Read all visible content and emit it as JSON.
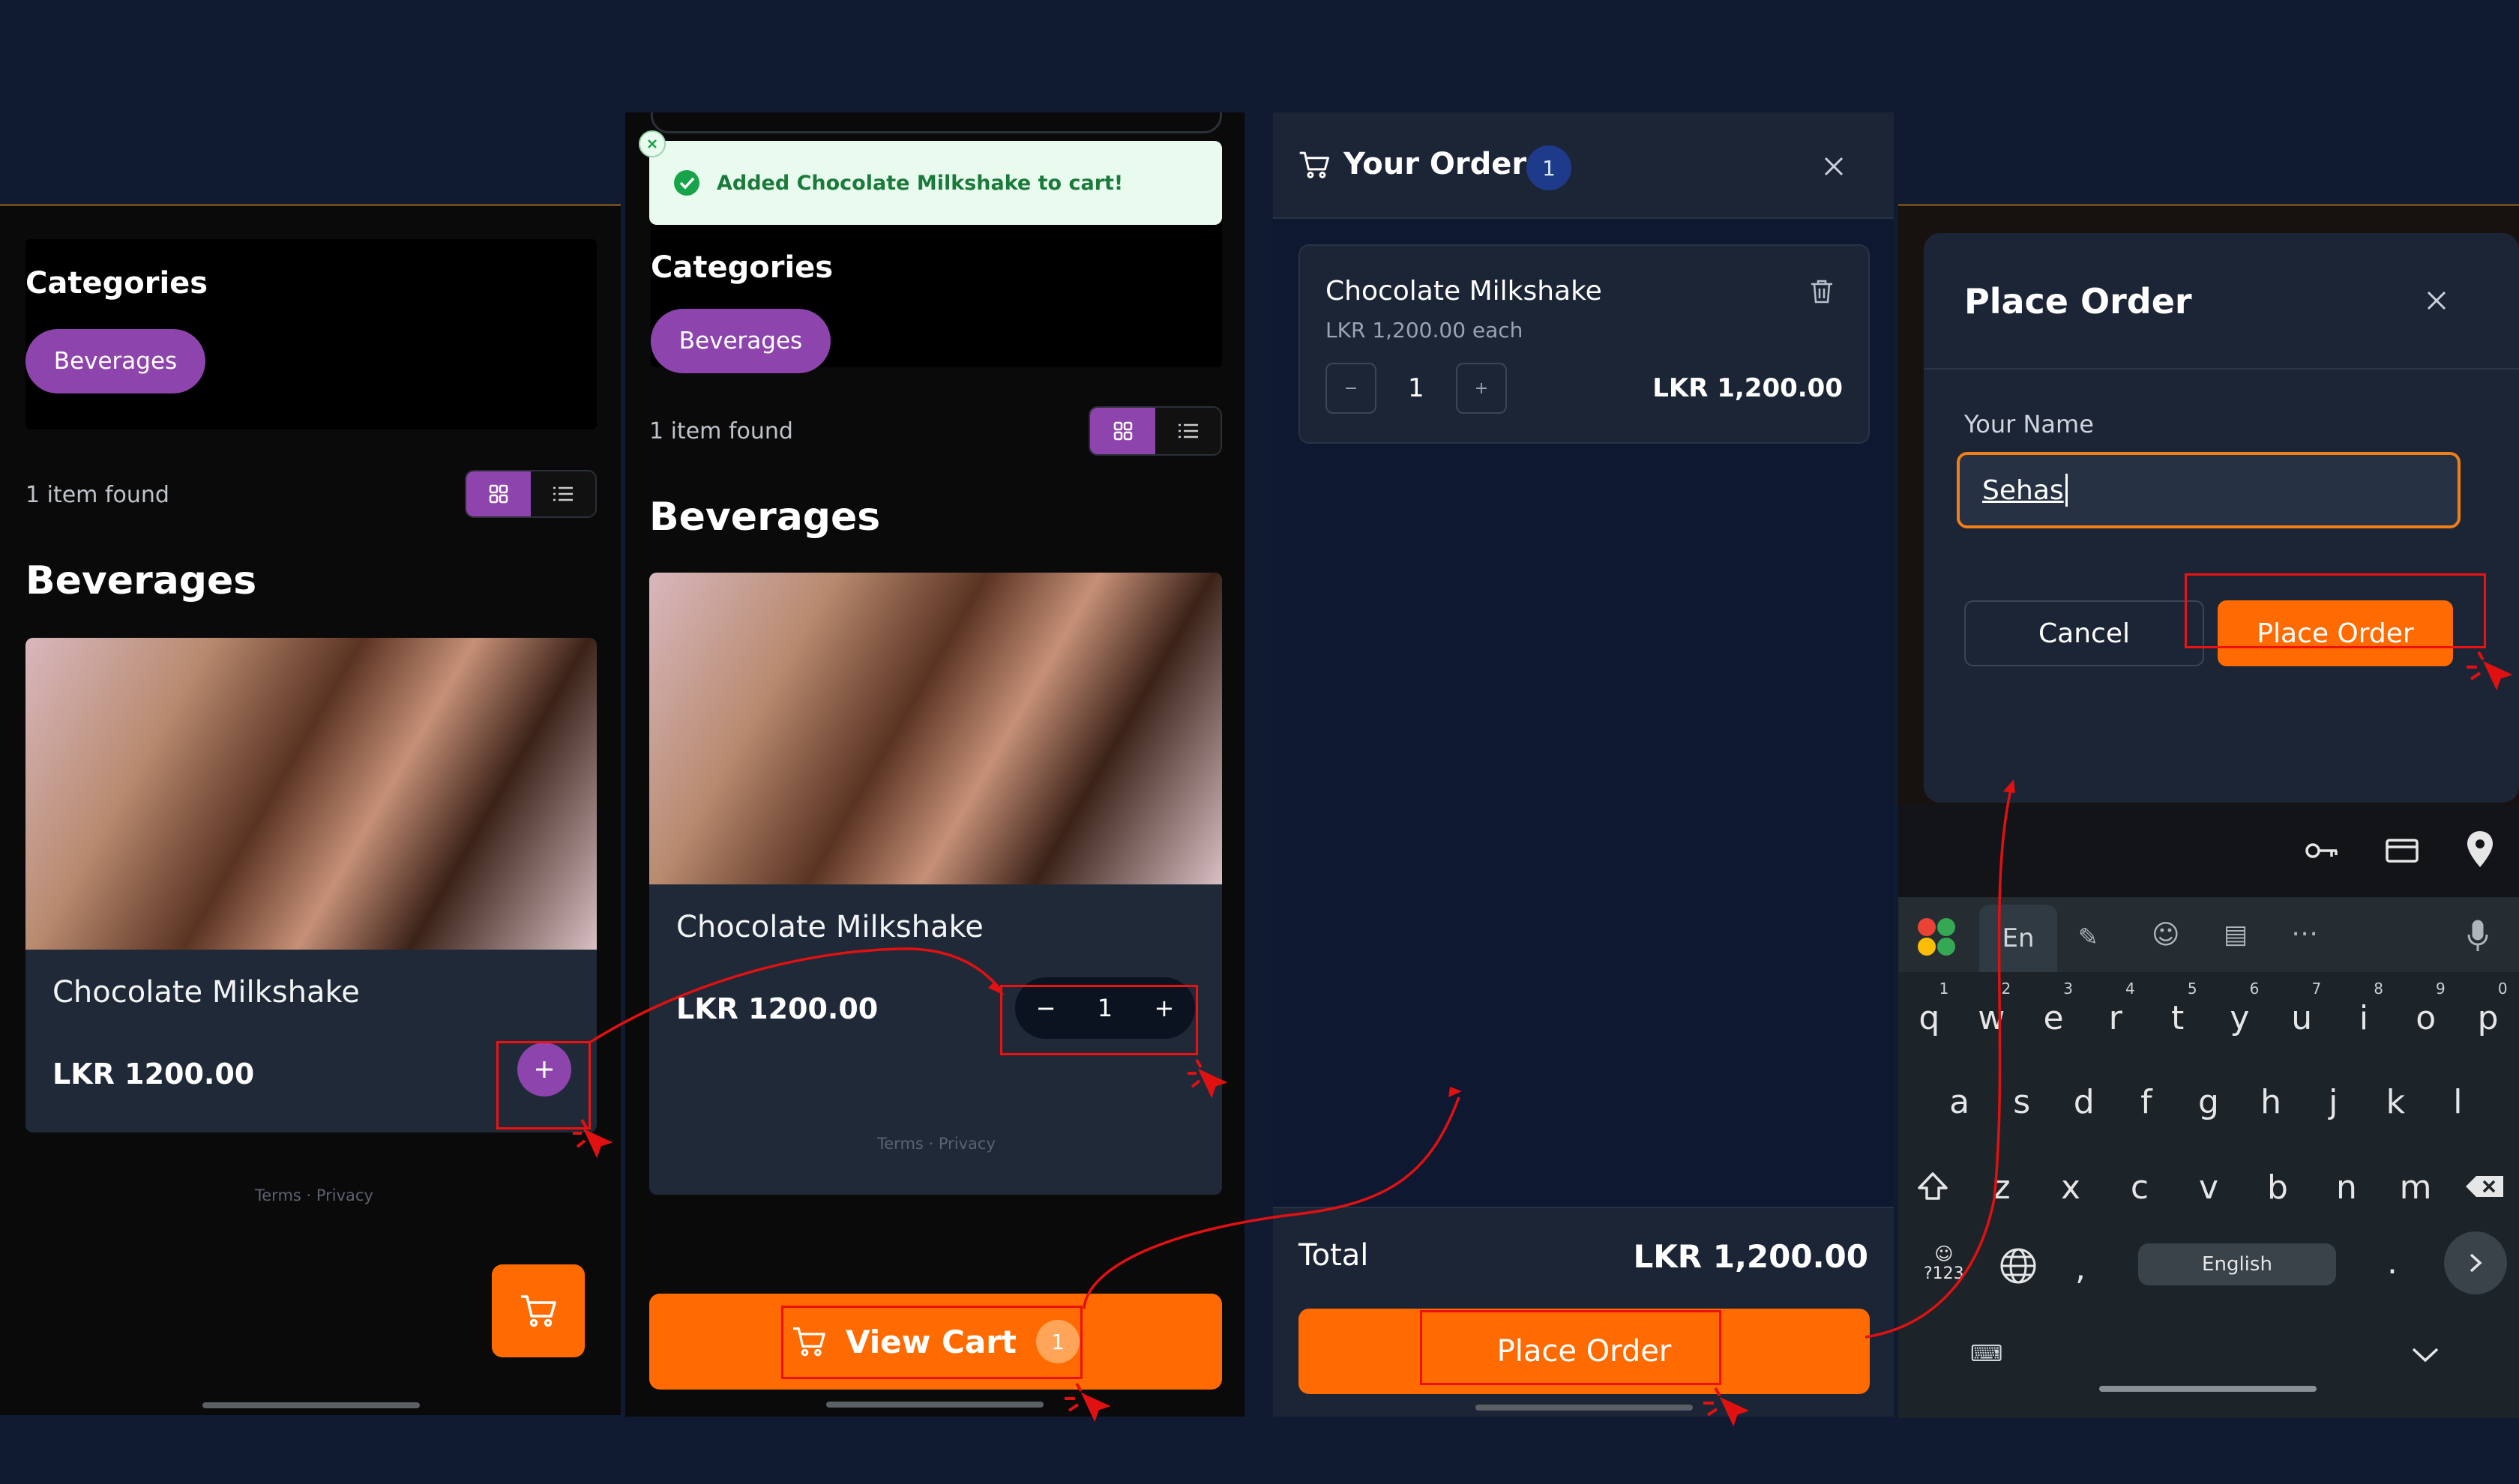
{
  "panel1": {
    "categories_title": "Categories",
    "category_pill": "Beverages",
    "items_found": "1 item found",
    "section_title": "Beverages",
    "product_name": "Chocolate Milkshake",
    "product_price": "LKR 1200.00",
    "legal": "Terms · Privacy",
    "icons": [
      "grid-icon",
      "list-icon",
      "plus-icon",
      "cart-icon"
    ]
  },
  "panel2": {
    "toast_text": "Added Chocolate Milkshake to cart!",
    "categories_title": "Categories",
    "category_pill": "Beverages",
    "items_found": "1 item found",
    "section_title": "Beverages",
    "product_name": "Chocolate Milkshake",
    "product_price": "LKR 1200.00",
    "qty_minus": "−",
    "qty_value": "1",
    "qty_plus": "+",
    "legal": "Terms · Privacy",
    "view_cart_label": "View Cart",
    "view_cart_count": "1"
  },
  "panel3": {
    "title": "Your Order",
    "count": "1",
    "item_name": "Chocolate Milkshake",
    "item_each": "LKR 1,200.00 each",
    "qty_minus": "−",
    "qty_value": "1",
    "qty_plus": "+",
    "line_total": "LKR 1,200.00",
    "total_label": "Total",
    "total_value": "LKR 1,200.00",
    "place_order": "Place Order"
  },
  "panel4": {
    "dialog_title": "Place Order",
    "name_label": "Your Name",
    "name_value": "Sehas",
    "cancel": "Cancel",
    "place_order": "Place Order",
    "kb_lang_tab": "En",
    "kb_space_label": "English",
    "kb_symbols": "?123",
    "row1": [
      "q",
      "w",
      "e",
      "r",
      "t",
      "y",
      "u",
      "i",
      "o",
      "p"
    ],
    "row1_nums": [
      "1",
      "2",
      "3",
      "4",
      "5",
      "6",
      "7",
      "8",
      "9",
      "0"
    ],
    "row2": [
      "a",
      "s",
      "d",
      "f",
      "g",
      "h",
      "j",
      "k",
      "l"
    ],
    "row3": [
      "z",
      "x",
      "c",
      "v",
      "b",
      "n",
      "m"
    ],
    "comma": ",",
    "period": "."
  },
  "colors": {
    "accent_purple": "#8e44ad",
    "accent_orange": "#ff6b00",
    "annotation_red": "#e11111",
    "input_border": "#f07f19"
  }
}
